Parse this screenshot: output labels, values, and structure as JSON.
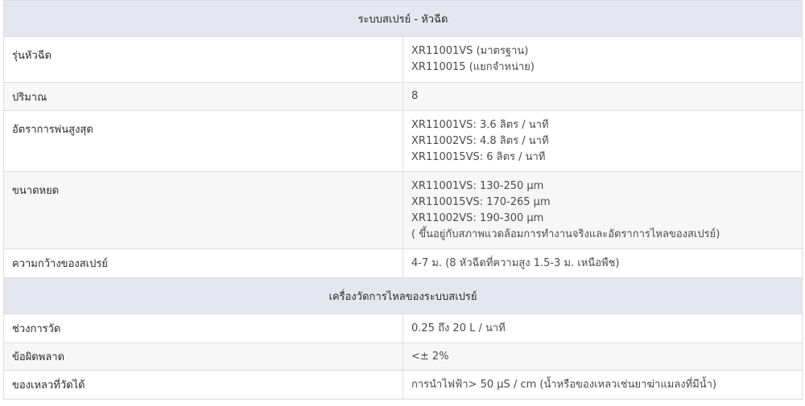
{
  "sections": [
    {
      "title": "ระบบสเปรย์ - หัวฉีด",
      "rows": [
        {
          "label": "รุ่นหัวฉีด",
          "lines": [
            "XR11001VS (มาตรฐาน)",
            "XR110015 (แยกจำหน่าย)"
          ]
        },
        {
          "label": "ปริมาณ",
          "lines": [
            "8"
          ]
        },
        {
          "label": "อัตราการพ่นสูงสุด",
          "lines": [
            "XR11001VS: 3.6 ลิตร / นาที",
            "XR11002VS: 4.8 ลิตร / นาที",
            "XR110015VS: 6 ลิตร / นาที"
          ]
        },
        {
          "label": "ขนาดหยด",
          "lines": [
            "XR11001VS: 130-250 μm",
            "XR110015VS: 170-265 μm",
            "XR11002VS: 190-300 μm",
            "( ขึ้นอยู่กับสภาพแวดล้อมการทำงานจริงและอัตราการไหลของสเปรย์)"
          ]
        },
        {
          "label": "ความกว้างของสเปรย์",
          "lines": [
            "4-7 ม. (8 หัวฉีดที่ความสูง 1.5-3 ม. เหนือพืช)"
          ]
        }
      ]
    },
    {
      "title": "เครื่องวัดการไหลของระบบสเปรย์",
      "rows": [
        {
          "label": "ช่วงการวัด",
          "lines": [
            "0.25 ถึง 20 L / นาที"
          ]
        },
        {
          "label": "ข้อผิดพลาด",
          "lines": [
            "<± 2%"
          ]
        },
        {
          "label": "ของเหลวที่วัดได้",
          "lines": [
            "การนำไฟฟ้า> 50 μS / cm (น้ำหรือของเหลวเช่นยาฆ่าแมลงที่มีน้ำ)"
          ]
        }
      ]
    }
  ]
}
